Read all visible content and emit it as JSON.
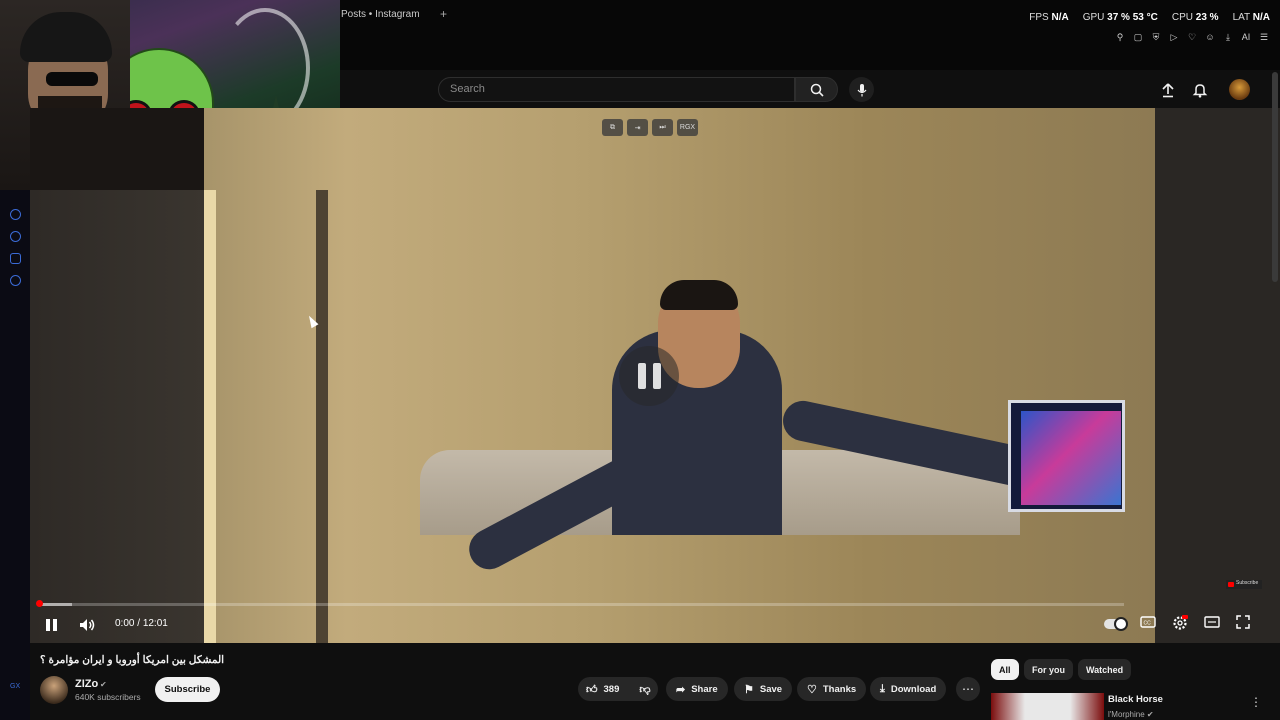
{
  "browser": {
    "tab_text": "Posts • Instagram",
    "new_tab": "+",
    "perf": {
      "fps_label": "FPS",
      "fps_value": "N/A",
      "gpu_label": "GPU",
      "gpu_value": "37 % 53 °C",
      "cpu_label": "CPU",
      "cpu_value": "23 %",
      "lat_label": "LAT",
      "lat_value": "N/A"
    },
    "ai_label": "AI",
    "gx_logo": "GX"
  },
  "masthead": {
    "search_placeholder": "Search"
  },
  "player": {
    "top_tools": [
      "⧉",
      "⇥",
      "⏭",
      "RGX"
    ],
    "current_time": "0:00",
    "duration": "12:01",
    "time_separator": " / ",
    "progress_fraction": 0.0,
    "watermark": "Subscribe"
  },
  "video": {
    "title": "المشكل بين امريكا أوروبا و ايران مؤامرة ؟",
    "channel_name": "ZIZo",
    "subscribers": "640K subscribers",
    "subscribe_label": "Subscribe",
    "likes": "389",
    "actions": {
      "share": "Share",
      "save": "Save",
      "thanks": "Thanks",
      "download": "Download"
    }
  },
  "sidebar": {
    "chips": [
      "All",
      "For you",
      "Watched"
    ],
    "related": {
      "title": "Black Horse",
      "channel": "l'Morphine"
    }
  },
  "colors": {
    "accent": "#ff0000",
    "background": "#0f0f0f",
    "gx_blue": "#3b6bd6"
  }
}
